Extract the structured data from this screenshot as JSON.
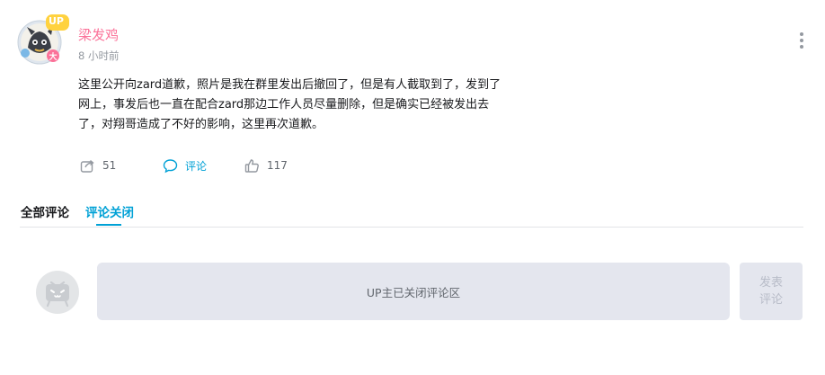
{
  "post": {
    "username": "梁发鸡",
    "time": "8 小时前",
    "content_lines": [
      "这里公开向zard道歉，照片是我在群里发出后撤回了，但是有人截取到了，发到了",
      "网上，事发后也一直在配合zard那边工作人员尽量删除，但是确实已经被发出去",
      "了，对翔哥造成了不好的影响，这里再次道歉。"
    ],
    "avatar_badge": "UP",
    "actions": {
      "share_icon": "share-icon",
      "share_count": "51",
      "comment_icon": "comment-icon",
      "comment_label": "评论",
      "like_icon": "thumbs-up-icon",
      "like_count": "117"
    }
  },
  "tabs": {
    "all_label": "全部评论",
    "closed_label": "评论关闭"
  },
  "comment_box": {
    "closed_message": "UP主已关闭评论区",
    "submit_label": "发表评论"
  },
  "colors": {
    "username": "#fb7299",
    "accent": "#00a1d6",
    "muted": "#9499a0",
    "input_bg": "#e4e6ee"
  }
}
